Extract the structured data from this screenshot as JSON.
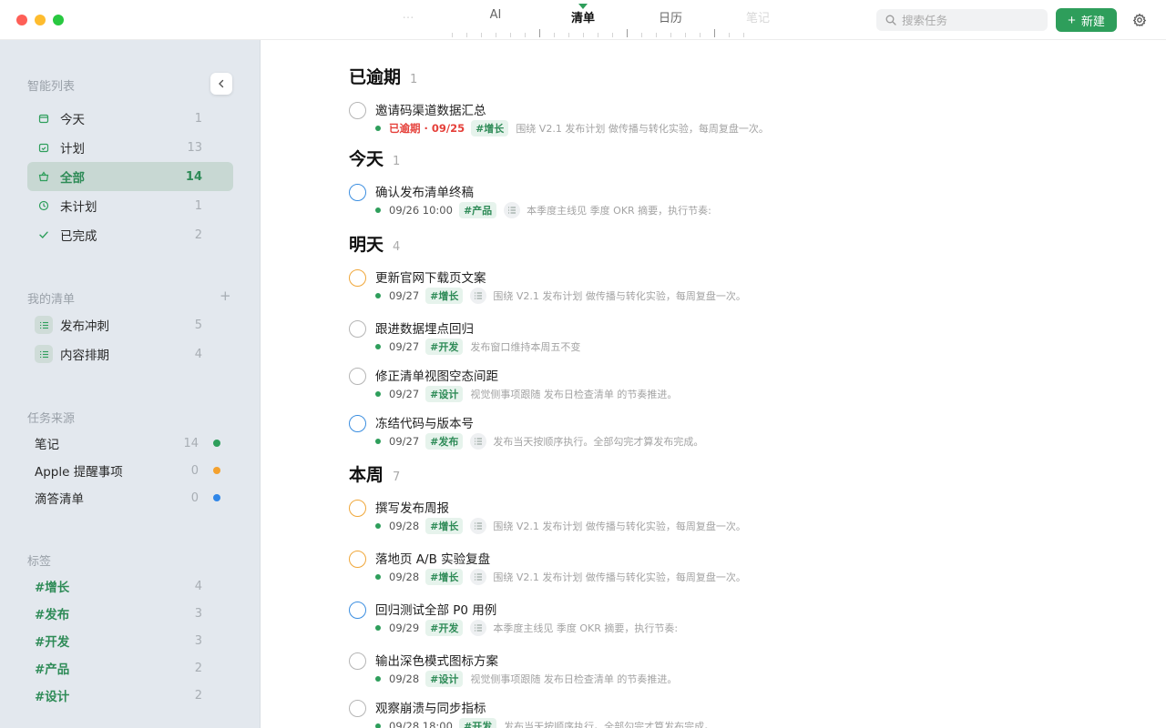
{
  "window": {
    "traffic_lights": [
      "#fe5f57",
      "#febc2e",
      "#28c840"
    ]
  },
  "header": {
    "tabs": [
      {
        "label": "…",
        "state": "faded"
      },
      {
        "label": "AI",
        "state": "normal"
      },
      {
        "label": "清单",
        "state": "active"
      },
      {
        "label": "日历",
        "state": "normal"
      },
      {
        "label": "笔记",
        "state": "faded"
      }
    ],
    "search_placeholder": "搜索任务",
    "new_label": "新建",
    "accent": "#2e9e5b"
  },
  "sidebar": {
    "smart_title": "智能列表",
    "smart_items": [
      {
        "label": "今天",
        "count": "1",
        "icon": "calendar-icon",
        "active": false
      },
      {
        "label": "计划",
        "count": "13",
        "icon": "calendar-check-icon",
        "active": false
      },
      {
        "label": "全部",
        "count": "14",
        "icon": "basket-icon",
        "active": true
      },
      {
        "label": "未计划",
        "count": "1",
        "icon": "clock-icon",
        "active": false
      },
      {
        "label": "已完成",
        "count": "2",
        "icon": "checkmark-icon",
        "active": false
      }
    ],
    "my_lists_title": "我的清单",
    "my_lists": [
      {
        "label": "发布冲刺",
        "count": "5"
      },
      {
        "label": "内容排期",
        "count": "4"
      }
    ],
    "sources_title": "任务来源",
    "sources": [
      {
        "label": "笔记",
        "count": "14",
        "color": "#2e9e5b"
      },
      {
        "label": "Apple 提醒事项",
        "count": "0",
        "color": "#f4a12e"
      },
      {
        "label": "滴答清单",
        "count": "0",
        "color": "#2f86e8"
      }
    ],
    "tags_title": "标签",
    "tags": [
      {
        "label": "#增长",
        "count": "4"
      },
      {
        "label": "#发布",
        "count": "3"
      },
      {
        "label": "#开发",
        "count": "3"
      },
      {
        "label": "#产品",
        "count": "2"
      },
      {
        "label": "#设计",
        "count": "2"
      }
    ]
  },
  "main": {
    "groups": [
      {
        "title": "已逾期",
        "count": "1",
        "tasks": [
          {
            "title": "邀请码渠道数据汇总",
            "date": "已逾期 · 09/25",
            "overdue": true,
            "tag": "#增长",
            "note_icon": false,
            "note": "围绕 V2.1 发布计划 做传播与转化实验，每周复盘一次。",
            "ring": "gray"
          }
        ]
      },
      {
        "title": "今天",
        "count": "1",
        "tasks": [
          {
            "title": "确认发布清单终稿",
            "date": "09/26 10:00",
            "overdue": false,
            "tag": "#产品",
            "note_icon": true,
            "note": "本季度主线见 季度 OKR 摘要，执行节奏:",
            "ring": "blue"
          }
        ]
      },
      {
        "title": "明天",
        "count": "4",
        "tasks": [
          {
            "title": "更新官网下载页文案",
            "date": "09/27",
            "overdue": false,
            "tag": "#增长",
            "note_icon": true,
            "note": "围绕 V2.1 发布计划 做传播与转化实验，每周复盘一次。",
            "ring": "orange"
          },
          {
            "title": "跟进数据埋点回归",
            "date": "09/27",
            "overdue": false,
            "tag": "#开发",
            "note_icon": false,
            "note": "发布窗口维持本周五不变",
            "ring": "gray"
          },
          {
            "title": "修正清单视图空态间距",
            "date": "09/27",
            "overdue": false,
            "tag": "#设计",
            "note_icon": false,
            "note": "视觉侧事项跟随 发布日检查清单 的节奏推进。",
            "ring": "gray"
          },
          {
            "title": "冻结代码与版本号",
            "date": "09/27",
            "overdue": false,
            "tag": "#发布",
            "note_icon": true,
            "note": "发布当天按顺序执行。全部勾完才算发布完成。",
            "ring": "blue"
          }
        ]
      },
      {
        "title": "本周",
        "count": "7",
        "tasks": [
          {
            "title": "撰写发布周报",
            "date": "09/28",
            "overdue": false,
            "tag": "#增长",
            "note_icon": true,
            "note": "围绕 V2.1 发布计划 做传播与转化实验，每周复盘一次。",
            "ring": "orange"
          },
          {
            "title": "落地页 A/B 实验复盘",
            "date": "09/28",
            "overdue": false,
            "tag": "#增长",
            "note_icon": true,
            "note": "围绕 V2.1 发布计划 做传播与转化实验，每周复盘一次。",
            "ring": "orange"
          },
          {
            "title": "回归测试全部 P0 用例",
            "date": "09/29",
            "overdue": false,
            "tag": "#开发",
            "note_icon": true,
            "note": "本季度主线见 季度 OKR 摘要，执行节奏:",
            "ring": "blue"
          },
          {
            "title": "输出深色模式图标方案",
            "date": "09/28",
            "overdue": false,
            "tag": "#设计",
            "note_icon": false,
            "note": "视觉侧事项跟随 发布日检查清单 的节奏推进。",
            "ring": "gray"
          },
          {
            "title": "观察崩溃与同步指标",
            "date": "09/28 18:00",
            "overdue": false,
            "tag": "#开发",
            "note_icon": false,
            "note": "发布当天按顺序执行。全部勾完才算发布完成。",
            "ring": "gray"
          }
        ]
      }
    ]
  }
}
